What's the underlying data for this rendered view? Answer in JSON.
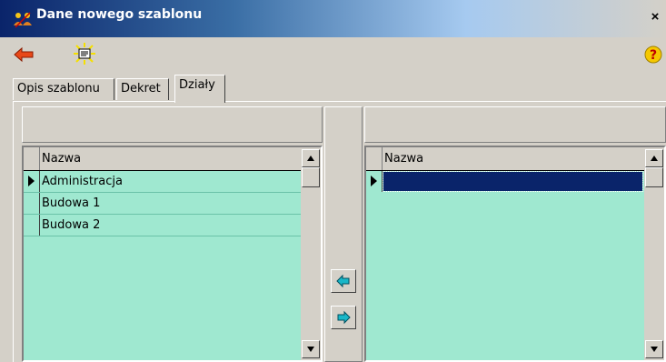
{
  "window": {
    "title": "Dane nowego szablonu",
    "close_glyph": "×"
  },
  "icons": {
    "app": "people-icon",
    "back": "arrow-left-icon",
    "properties": "properties-sheet-icon",
    "help": "help-icon"
  },
  "tabs": [
    {
      "label": "Opis szablonu",
      "active": false
    },
    {
      "label": "Dekret",
      "active": false
    },
    {
      "label": "Działy",
      "active": true
    }
  ],
  "left_grid": {
    "column_header": "Nazwa",
    "rows": [
      {
        "name": "Administracja",
        "current": true
      },
      {
        "name": "Budowa 1",
        "current": false
      },
      {
        "name": "Budowa 2",
        "current": false
      }
    ]
  },
  "right_grid": {
    "column_header": "Nazwa",
    "rows": [
      {
        "name": "",
        "current": true,
        "selected": true
      }
    ]
  },
  "colors": {
    "grid_bg": "#9fe8d0",
    "selection": "#0a246a",
    "titlebar": "#0a246a",
    "window_bg": "#d4d0c8"
  }
}
